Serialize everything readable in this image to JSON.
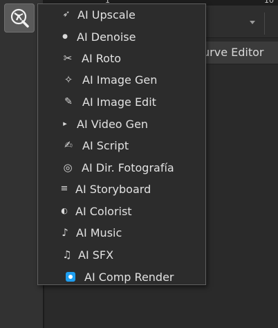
{
  "ruler": {
    "left_number": "1",
    "right_number": "10"
  },
  "tabs": {
    "curve_editor_label": "urve Editor"
  },
  "tool_button": {
    "icon": "ai-tools-icon"
  },
  "colors": {
    "comp_render_accent": "#1e9ef0"
  },
  "menu": {
    "items": [
      {
        "label": "AI Upscale",
        "icon": "upscale-icon",
        "glyph": "➶"
      },
      {
        "label": "AI Denoise",
        "icon": "denoise-icon",
        "glyph": "●"
      },
      {
        "label": "AI Roto",
        "icon": "scissors-icon",
        "glyph": "✂"
      },
      {
        "label": "AI Image Gen",
        "icon": "sparkle-icon",
        "glyph": "✧"
      },
      {
        "label": "AI Image Edit",
        "icon": "pencil-icon",
        "glyph": "✎"
      },
      {
        "label": "AI Video Gen",
        "icon": "play-icon",
        "glyph": "▸"
      },
      {
        "label": "AI Script",
        "icon": "writing-icon",
        "glyph": "✍"
      },
      {
        "label": "AI Dir. Fotografía",
        "icon": "target-icon",
        "glyph": "◎"
      },
      {
        "label": "AI Storyboard",
        "icon": "storyboard-icon",
        "glyph": "≡"
      },
      {
        "label": "AI Colorist",
        "icon": "half-circle-icon",
        "glyph": "◐"
      },
      {
        "label": "AI Music",
        "icon": "music-note-icon",
        "glyph": "♪"
      },
      {
        "label": "AI SFX",
        "icon": "beamed-notes-icon",
        "glyph": "♫"
      },
      {
        "label": "AI Comp Render",
        "icon": "comp-render-icon",
        "glyph": ""
      }
    ]
  }
}
